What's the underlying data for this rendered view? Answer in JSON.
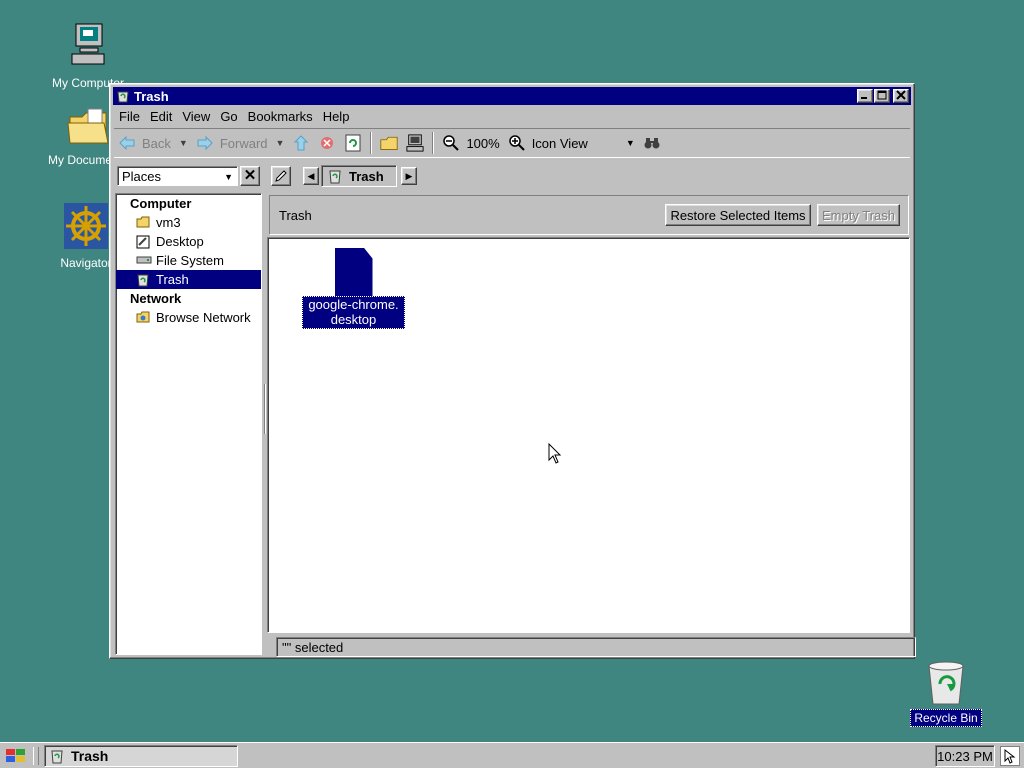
{
  "desktop": {
    "icons": [
      {
        "label": "My Computer"
      },
      {
        "label": "My Documents"
      },
      {
        "label": "Navigator"
      },
      {
        "label": "Recycle Bin"
      }
    ]
  },
  "window": {
    "title": "Trash",
    "menu": [
      "File",
      "Edit",
      "View",
      "Go",
      "Bookmarks",
      "Help"
    ],
    "toolbar": {
      "back": "Back",
      "forward": "Forward",
      "zoom": "100%",
      "view_mode": "Icon View"
    },
    "places_select": "Places",
    "path_button": "Trash",
    "sidebar": {
      "computer_header": "Computer",
      "computer_items": [
        "vm3",
        "Desktop",
        "File System",
        "Trash"
      ],
      "selected": "Trash",
      "network_header": "Network",
      "network_items": [
        "Browse Network"
      ]
    },
    "trash_bar": {
      "label": "Trash",
      "restore_button": "Restore Selected Items",
      "empty_button": "Empty Trash"
    },
    "files": [
      {
        "line1": "google-chrome.",
        "line2": "desktop"
      }
    ],
    "status": "\"\" selected"
  },
  "taskbar": {
    "task_label": "Trash",
    "clock": "10:23 PM"
  }
}
